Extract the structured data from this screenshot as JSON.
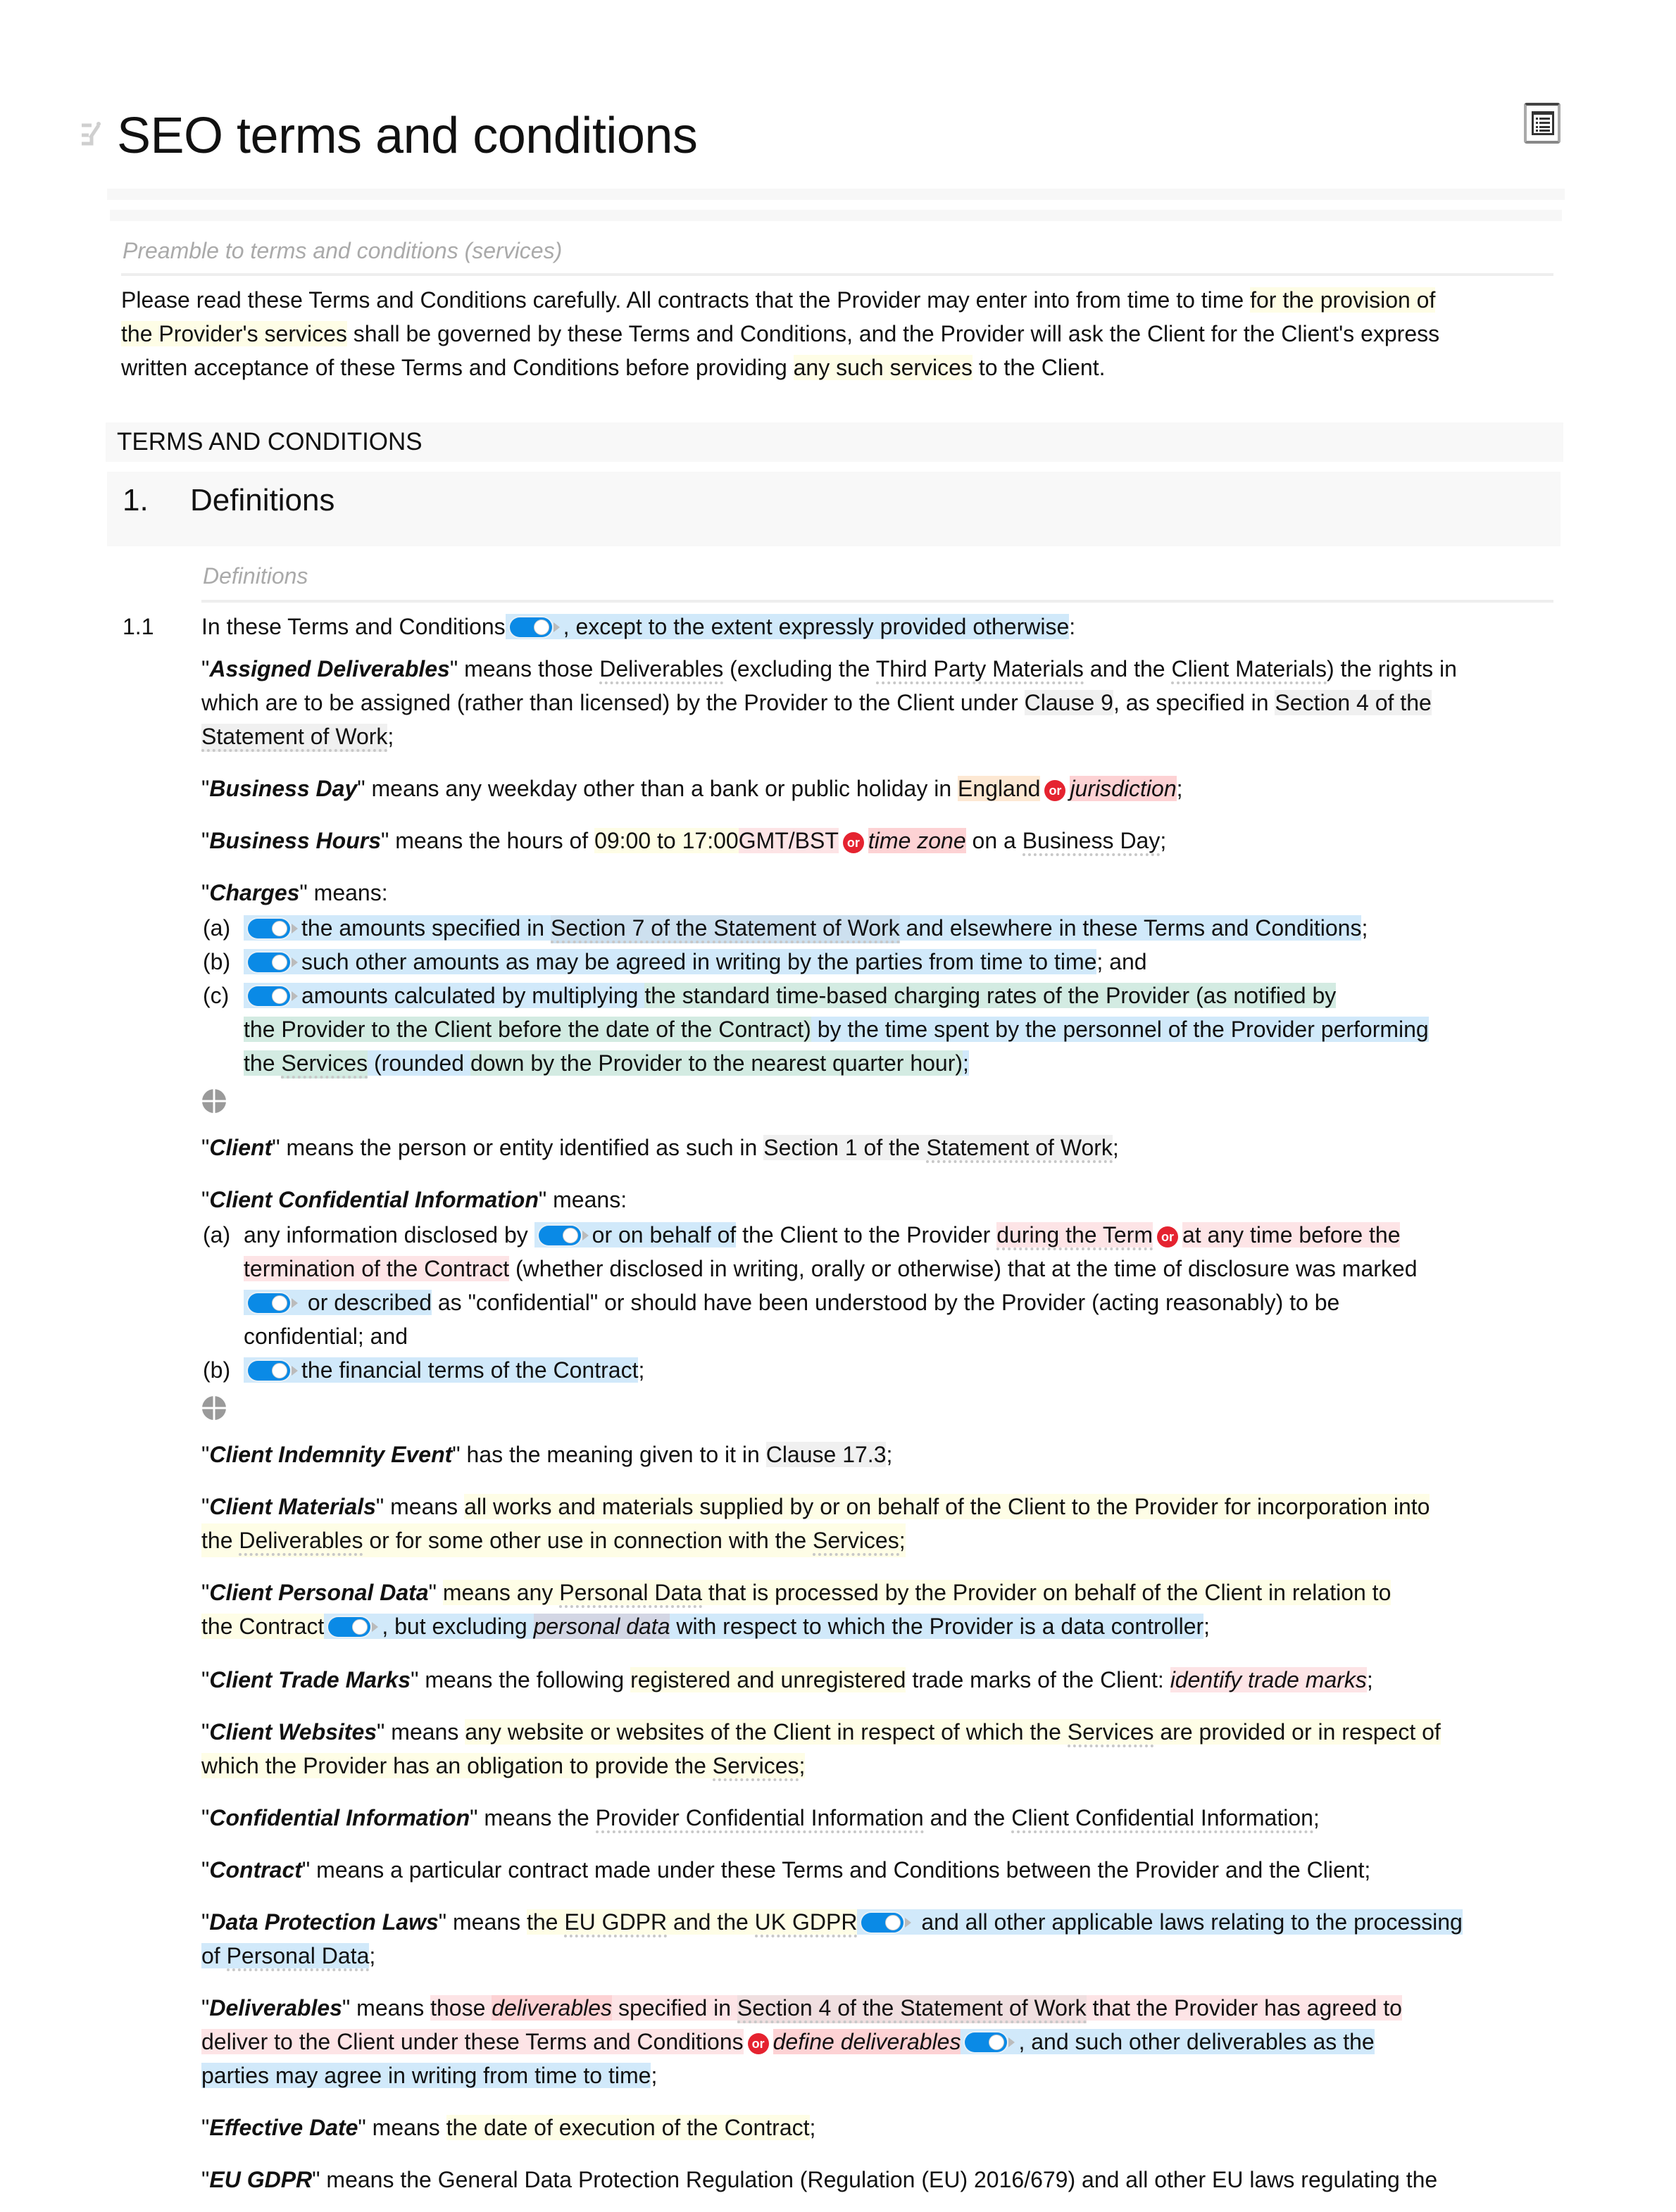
{
  "document": {
    "title": "SEO terms and conditions",
    "icons": {
      "edit": "edit-pencil-icon",
      "toc": "table-of-contents-icon",
      "add": "add-circle-icon",
      "toggle": "toggle-switch-icon",
      "or": "or-badge"
    },
    "colors": {
      "toggle_on": "#0a8ae6",
      "or_badge": "#e52330",
      "highlight_optional": "#d1e9fa",
      "highlight_variable": "#fefde6",
      "highlight_choice": "#fde4e6",
      "highlight_placeholder": "#fdd2d4",
      "highlight_green": "#d3ebe2"
    }
  },
  "preamble": {
    "label": "Preamble to terms and conditions (services)",
    "text_1": "Please read these Terms and Conditions carefully. All contracts that the Provider may enter into from time to time ",
    "var_1a": "for the provision of",
    "var_1b": "the Provider's services",
    "text_2": " shall be governed by these Terms and Conditions, and the Provider will ask the Client for the Client's express",
    "text_3": "written acceptance of these Terms and Conditions before providing ",
    "var_2": "any such services",
    "text_4": " to the Client."
  },
  "terms_heading": "TERMS AND CONDITIONS",
  "section": {
    "number": "1.",
    "title": "Definitions",
    "sublabel": "Definitions"
  },
  "clause_1_1": {
    "number": "1.1",
    "intro": "In these Terms and Conditions",
    "intro_optional": ", except to the extent expressly provided otherwise",
    "intro_end": ":"
  },
  "defs": {
    "assigned": {
      "term": "Assigned Deliverables",
      "l1a": "\" means those ",
      "l1_ref1": "Deliverables",
      "l1b": " (excluding the ",
      "l1_ref2": "Third Party Materials",
      "l1c": " and the ",
      "l1_ref3": "Client Materials",
      "l1d": ") the rights in",
      "l2a": "which are to be assigned (rather than licensed) by the Provider to the Client under ",
      "l2_ref1": "Clause 9",
      "l2b": ", as specified in ",
      "l2_ref2": "Section 4 of the",
      "l3_ref": "Statement of Work",
      "l3b": ";"
    },
    "business_day": {
      "term": "Business Day",
      "a": "\" means any weekday other than a bank or public holiday in ",
      "opt1": "England",
      "or": "or",
      "opt2": "jurisdiction",
      "end": ";"
    },
    "business_hours": {
      "term": "Business Hours",
      "a": "\" means the hours of ",
      "var": "09:00 to 17:00",
      "opt1": "GMT/BST",
      "or": "or",
      "opt2": "time zone",
      "b": " on a ",
      "ref": "Business Day",
      "end": ";"
    },
    "charges": {
      "term": "Charges",
      "a": "\" means:",
      "items": [
        {
          "letter": "(a)",
          "t1": "the amounts specified in ",
          "ref": "Section 7 of the Statement of Work",
          "t2": " and elsewhere in these Terms and Conditions",
          "end": ";"
        },
        {
          "letter": "(b)",
          "t1": "such other amounts as may be agreed in writing by the parties from time to time",
          "end": "; and"
        },
        {
          "letter": "(c)",
          "t1": "amounts calculated by multiplying ",
          "g1": "the standard time-based charging rates of the Provider (as notified by",
          "g2": "the Provider to the Client before the date of the Contract)",
          "t2": " by the time spent by the personnel of the Provider performing",
          "g3a": "the ",
          "ref": "Services",
          "b3": " (rounded ",
          "g3b": "down by the Provider to the nearest quarter hour)",
          "end": ";"
        }
      ]
    },
    "client": {
      "term": "Client",
      "a": "\" means the person or entity identified as such in ",
      "ref1": "Section 1 of the ",
      "ref2": "Statement of Work",
      "end": ";"
    },
    "cci": {
      "term": "Client Confidential Information",
      "a": "\" means:",
      "a_letter": "(a)",
      "a1": "any information disclosed by ",
      "a_opt1": "or on behalf of",
      "a2": " the Client to the Provider ",
      "a_ch1": "during the Term",
      "or": "or",
      "a_ch2a": "at any time before the",
      "a_ch2b": "termination of the Contract",
      "a3": " (whether disclosed in writing, orally or otherwise) that at the time of disclosure was marked",
      "a_opt2": " or described",
      "a4": " as \"confidential\" or should have been understood by the Provider (acting reasonably) to be",
      "a5": "confidential; and",
      "b_letter": "(b)",
      "b1": "the financial terms of the Contract",
      "b_end": ";"
    },
    "cie": {
      "term": "Client Indemnity Event",
      "a": "\" has the meaning given to it in ",
      "ref": "Clause 17.3",
      "end": ";"
    },
    "materials": {
      "term": "Client Materials",
      "a": "\" means ",
      "v1": "all works and materials supplied by or on behalf of the Client to the Provider for incorporation into",
      "v2a": "the ",
      "ref1": "Deliverables",
      "v2b": " or for some other use in connection with the ",
      "ref2": "Services",
      "end": ";"
    },
    "cpd": {
      "term": "Client Personal Data",
      "a": "\" ",
      "v1a": "means any ",
      "ref": "Personal Data",
      "v1b": " that is processed by the Provider on behalf of the Client in relation to",
      "v2": "the Contract",
      "opt1": ", but excluding ",
      "opt_i": "personal data",
      "opt2": " with respect to which the Provider is a data controller",
      "end": ";"
    },
    "ctm": {
      "term": "Client Trade Marks",
      "a": "\" means the following ",
      "var": "registered and unregistered",
      "b": " trade marks of the Client: ",
      "ph": "identify trade marks",
      "end": ";"
    },
    "cw": {
      "term": "Client Websites",
      "a": "\" means ",
      "v1a": "any website or websites of the Client in respect of which the ",
      "ref1": "Services",
      "v1b": " are provided or in respect of",
      "v2a": "which the Provider has an obligation to provide the ",
      "ref2": "Services",
      "end": ";"
    },
    "ci": {
      "term": "Confidential Information",
      "a": "\" means the ",
      "ref1": "Provider Confidential Information",
      "b": " and the ",
      "ref2": "Client Confidential Information",
      "end": ";"
    },
    "contract": {
      "term": "Contract",
      "a": "\" means a particular contract made under these Terms and Conditions between the Provider and the Client;"
    },
    "dpl": {
      "term": "Data Protection Laws",
      "a": "\" means ",
      "v1": "the ",
      "ref1": "EU GDPR",
      "v2": " and the ",
      "ref2": "UK GDPR",
      "opt1": " and all other applicable laws relating to the processing",
      "opt2a": "of ",
      "ref3": "Personal Data",
      "end": ";"
    },
    "deliverables": {
      "term": "Deliverables",
      "a": "\" means ",
      "c1": "those ",
      "ph1": "deliverables",
      "c2": " specified in ",
      "ref": "Section 4 of the Statement of Work",
      "c3": " that the Provider has agreed to",
      "c4": "deliver to the Client under these Terms and Conditions",
      "or": "or",
      "ph2": "define deliverables",
      "opt1": ", and such other deliverables as the",
      "opt2": "parties may agree in writing from time to time",
      "end": ";"
    },
    "effective": {
      "term": "Effective Date",
      "a": "\" means ",
      "var": "the date of execution of the Contract",
      "end": ";"
    },
    "eugdpr": {
      "term": "EU GDPR",
      "a": "\" means the General Data Protection Regulation (Regulation (EU) 2016/679) and all other EU laws regulating the"
    }
  }
}
